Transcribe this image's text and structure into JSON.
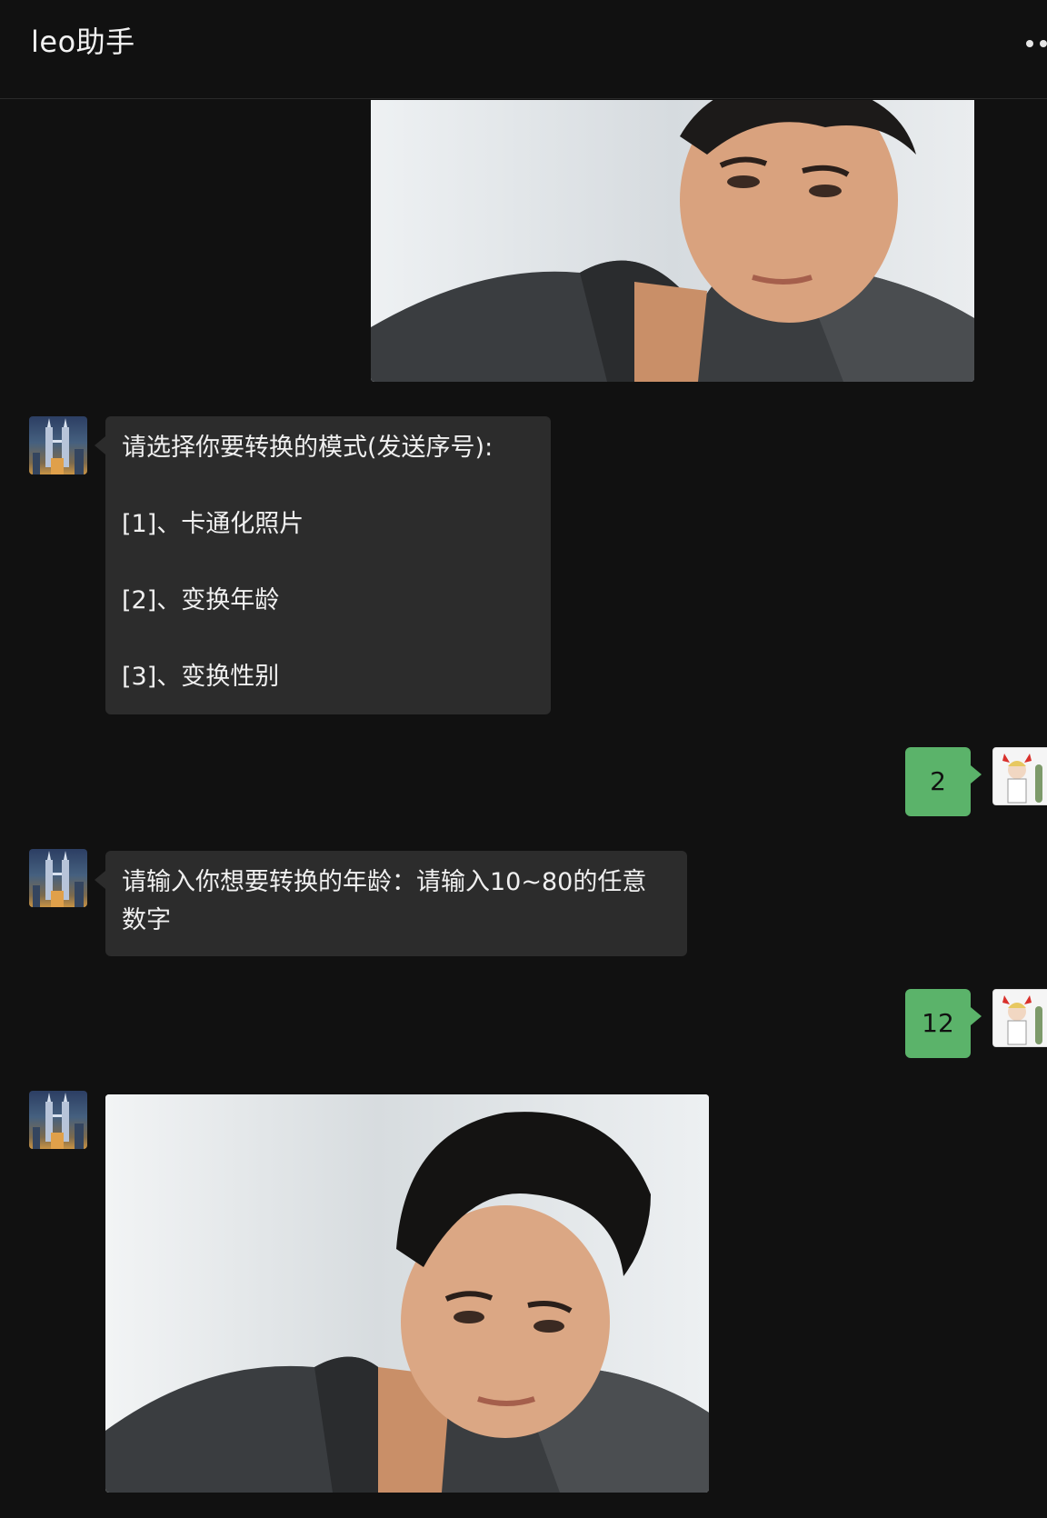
{
  "header": {
    "title": "leo助手",
    "more_icon": "more-dots-icon"
  },
  "messages": [
    {
      "from": "user",
      "type": "image",
      "description_icon": "portrait-photo"
    },
    {
      "from": "bot",
      "type": "text",
      "lines": [
        "请选择你要转换的模式(发送序号):",
        " [1]、卡通化照片",
        "[2]、变换年龄",
        "[3]、变换性别"
      ]
    },
    {
      "from": "user",
      "type": "text",
      "text": "2"
    },
    {
      "from": "bot",
      "type": "text",
      "lines": [
        "请输入你想要转换的年龄：请输入10~80的任意",
        "数字"
      ]
    },
    {
      "from": "user",
      "type": "text",
      "text": "12"
    },
    {
      "from": "bot",
      "type": "image",
      "description_icon": "portrait-photo"
    }
  ],
  "colors": {
    "background": "#111111",
    "bot_bubble": "#2c2c2c",
    "user_bubble": "#5bb36a"
  }
}
